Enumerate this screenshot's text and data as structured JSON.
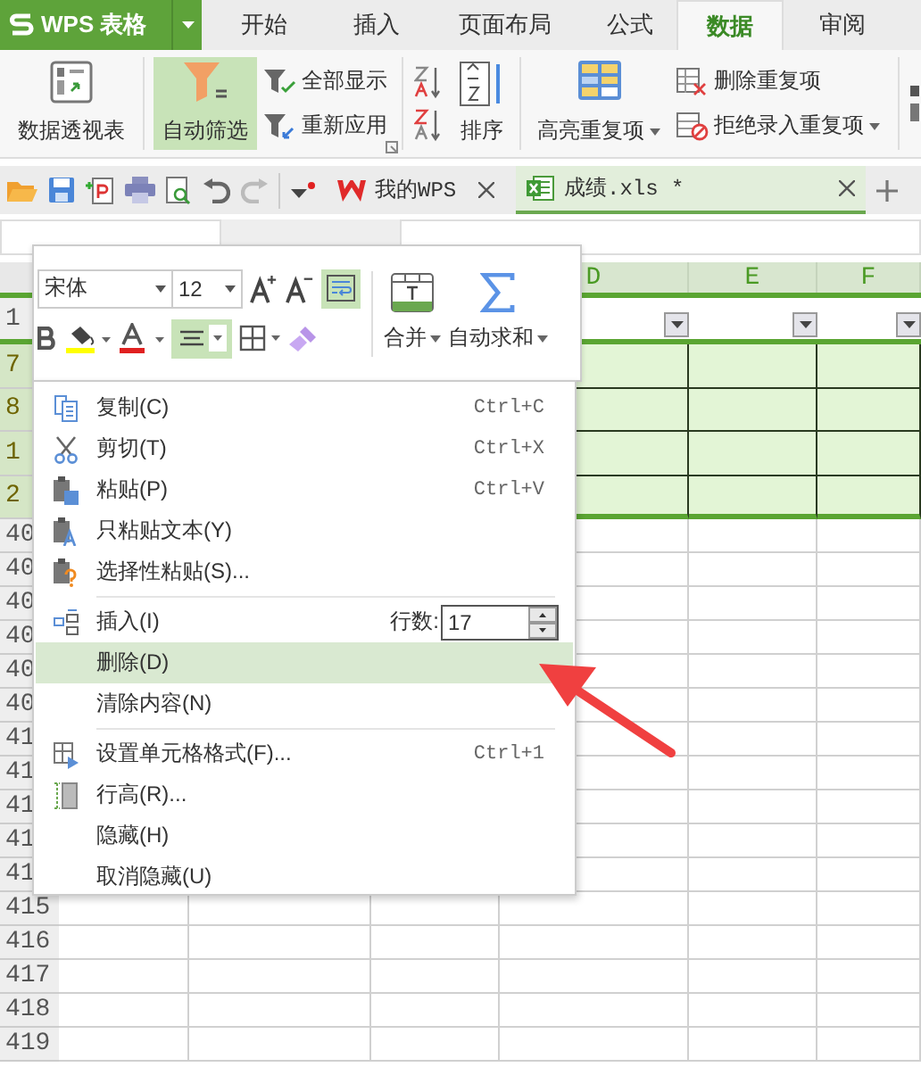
{
  "title_bar": {
    "app_name": "WPS 表格"
  },
  "ribbon_tabs": [
    {
      "label": "开始",
      "selected": false
    },
    {
      "label": "插入",
      "selected": false
    },
    {
      "label": "页面布局",
      "selected": false
    },
    {
      "label": "公式",
      "selected": false
    },
    {
      "label": "数据",
      "selected": true
    },
    {
      "label": "审阅",
      "selected": false
    }
  ],
  "ribbon": {
    "pivot_table": "数据透视表",
    "auto_filter": {
      "label": "自动筛选",
      "selected": true
    },
    "show_all": "全部显示",
    "reapply": "重新应用",
    "sort": "排序",
    "highlight_duplicates": "高亮重复项",
    "remove_duplicates": "删除重复项",
    "reject_duplicates": "拒绝录入重复项"
  },
  "doc_tabs": [
    {
      "label": "我的WPS",
      "selected": false
    },
    {
      "label": "成绩.xls *",
      "selected": true
    }
  ],
  "sheet": {
    "columns": [
      {
        "letter": "D",
        "filter_button": true
      },
      {
        "letter": "E",
        "filter_button": true
      },
      {
        "letter": "F",
        "filter_button": true
      }
    ],
    "rows": [
      {
        "number": "1",
        "kind": "header"
      },
      {
        "number": "7",
        "kind": "filtered"
      },
      {
        "number": "8",
        "kind": "filtered"
      },
      {
        "number": "1",
        "kind": "filtered"
      },
      {
        "number": "2",
        "kind": "filtered"
      },
      {
        "number": "40",
        "kind": "plain"
      },
      {
        "number": "40",
        "kind": "plain"
      },
      {
        "number": "40",
        "kind": "plain"
      },
      {
        "number": "40",
        "kind": "plain"
      },
      {
        "number": "40",
        "kind": "plain"
      },
      {
        "number": "40",
        "kind": "plain"
      },
      {
        "number": "41",
        "kind": "plain"
      },
      {
        "number": "41",
        "kind": "plain"
      },
      {
        "number": "41",
        "kind": "plain"
      },
      {
        "number": "41",
        "kind": "plain"
      },
      {
        "number": "41",
        "kind": "plain"
      },
      {
        "number": "415",
        "kind": "plain"
      },
      {
        "number": "416",
        "kind": "plain"
      },
      {
        "number": "417",
        "kind": "plain"
      },
      {
        "number": "418",
        "kind": "plain"
      },
      {
        "number": "419",
        "kind": "plain"
      }
    ]
  },
  "mini_toolbar": {
    "font": "宋体",
    "size": "12",
    "wrap_text_on": true,
    "center_align_on": true,
    "merge": "合并",
    "autosum": "自动求和"
  },
  "context_menu": {
    "items": [
      {
        "kind": "item",
        "label": "复制(C)",
        "shortcut": "Ctrl+C",
        "selected": false
      },
      {
        "kind": "item",
        "label": "剪切(T)",
        "shortcut": "Ctrl+X",
        "selected": false
      },
      {
        "kind": "item",
        "label": "粘贴(P)",
        "shortcut": "Ctrl+V",
        "selected": false
      },
      {
        "kind": "item",
        "label": "只粘贴文本(Y)",
        "selected": false
      },
      {
        "kind": "item",
        "label": "选择性粘贴(S)...",
        "selected": false
      },
      {
        "kind": "separator"
      },
      {
        "kind": "rows",
        "label": "插入(I)",
        "count_label": "行数:",
        "count": "17",
        "selected": false
      },
      {
        "kind": "item",
        "label": "删除(D)",
        "selected": true
      },
      {
        "kind": "item",
        "label": "清除内容(N)",
        "selected": false
      },
      {
        "kind": "separator"
      },
      {
        "kind": "item",
        "label": "设置单元格格式(F)...",
        "shortcut": "Ctrl+1",
        "selected": false
      },
      {
        "kind": "item",
        "label": "行高(R)...",
        "selected": false
      },
      {
        "kind": "item",
        "label": "隐藏(H)",
        "selected": false
      },
      {
        "kind": "item",
        "label": "取消隐藏(U)",
        "selected": false
      }
    ]
  }
}
